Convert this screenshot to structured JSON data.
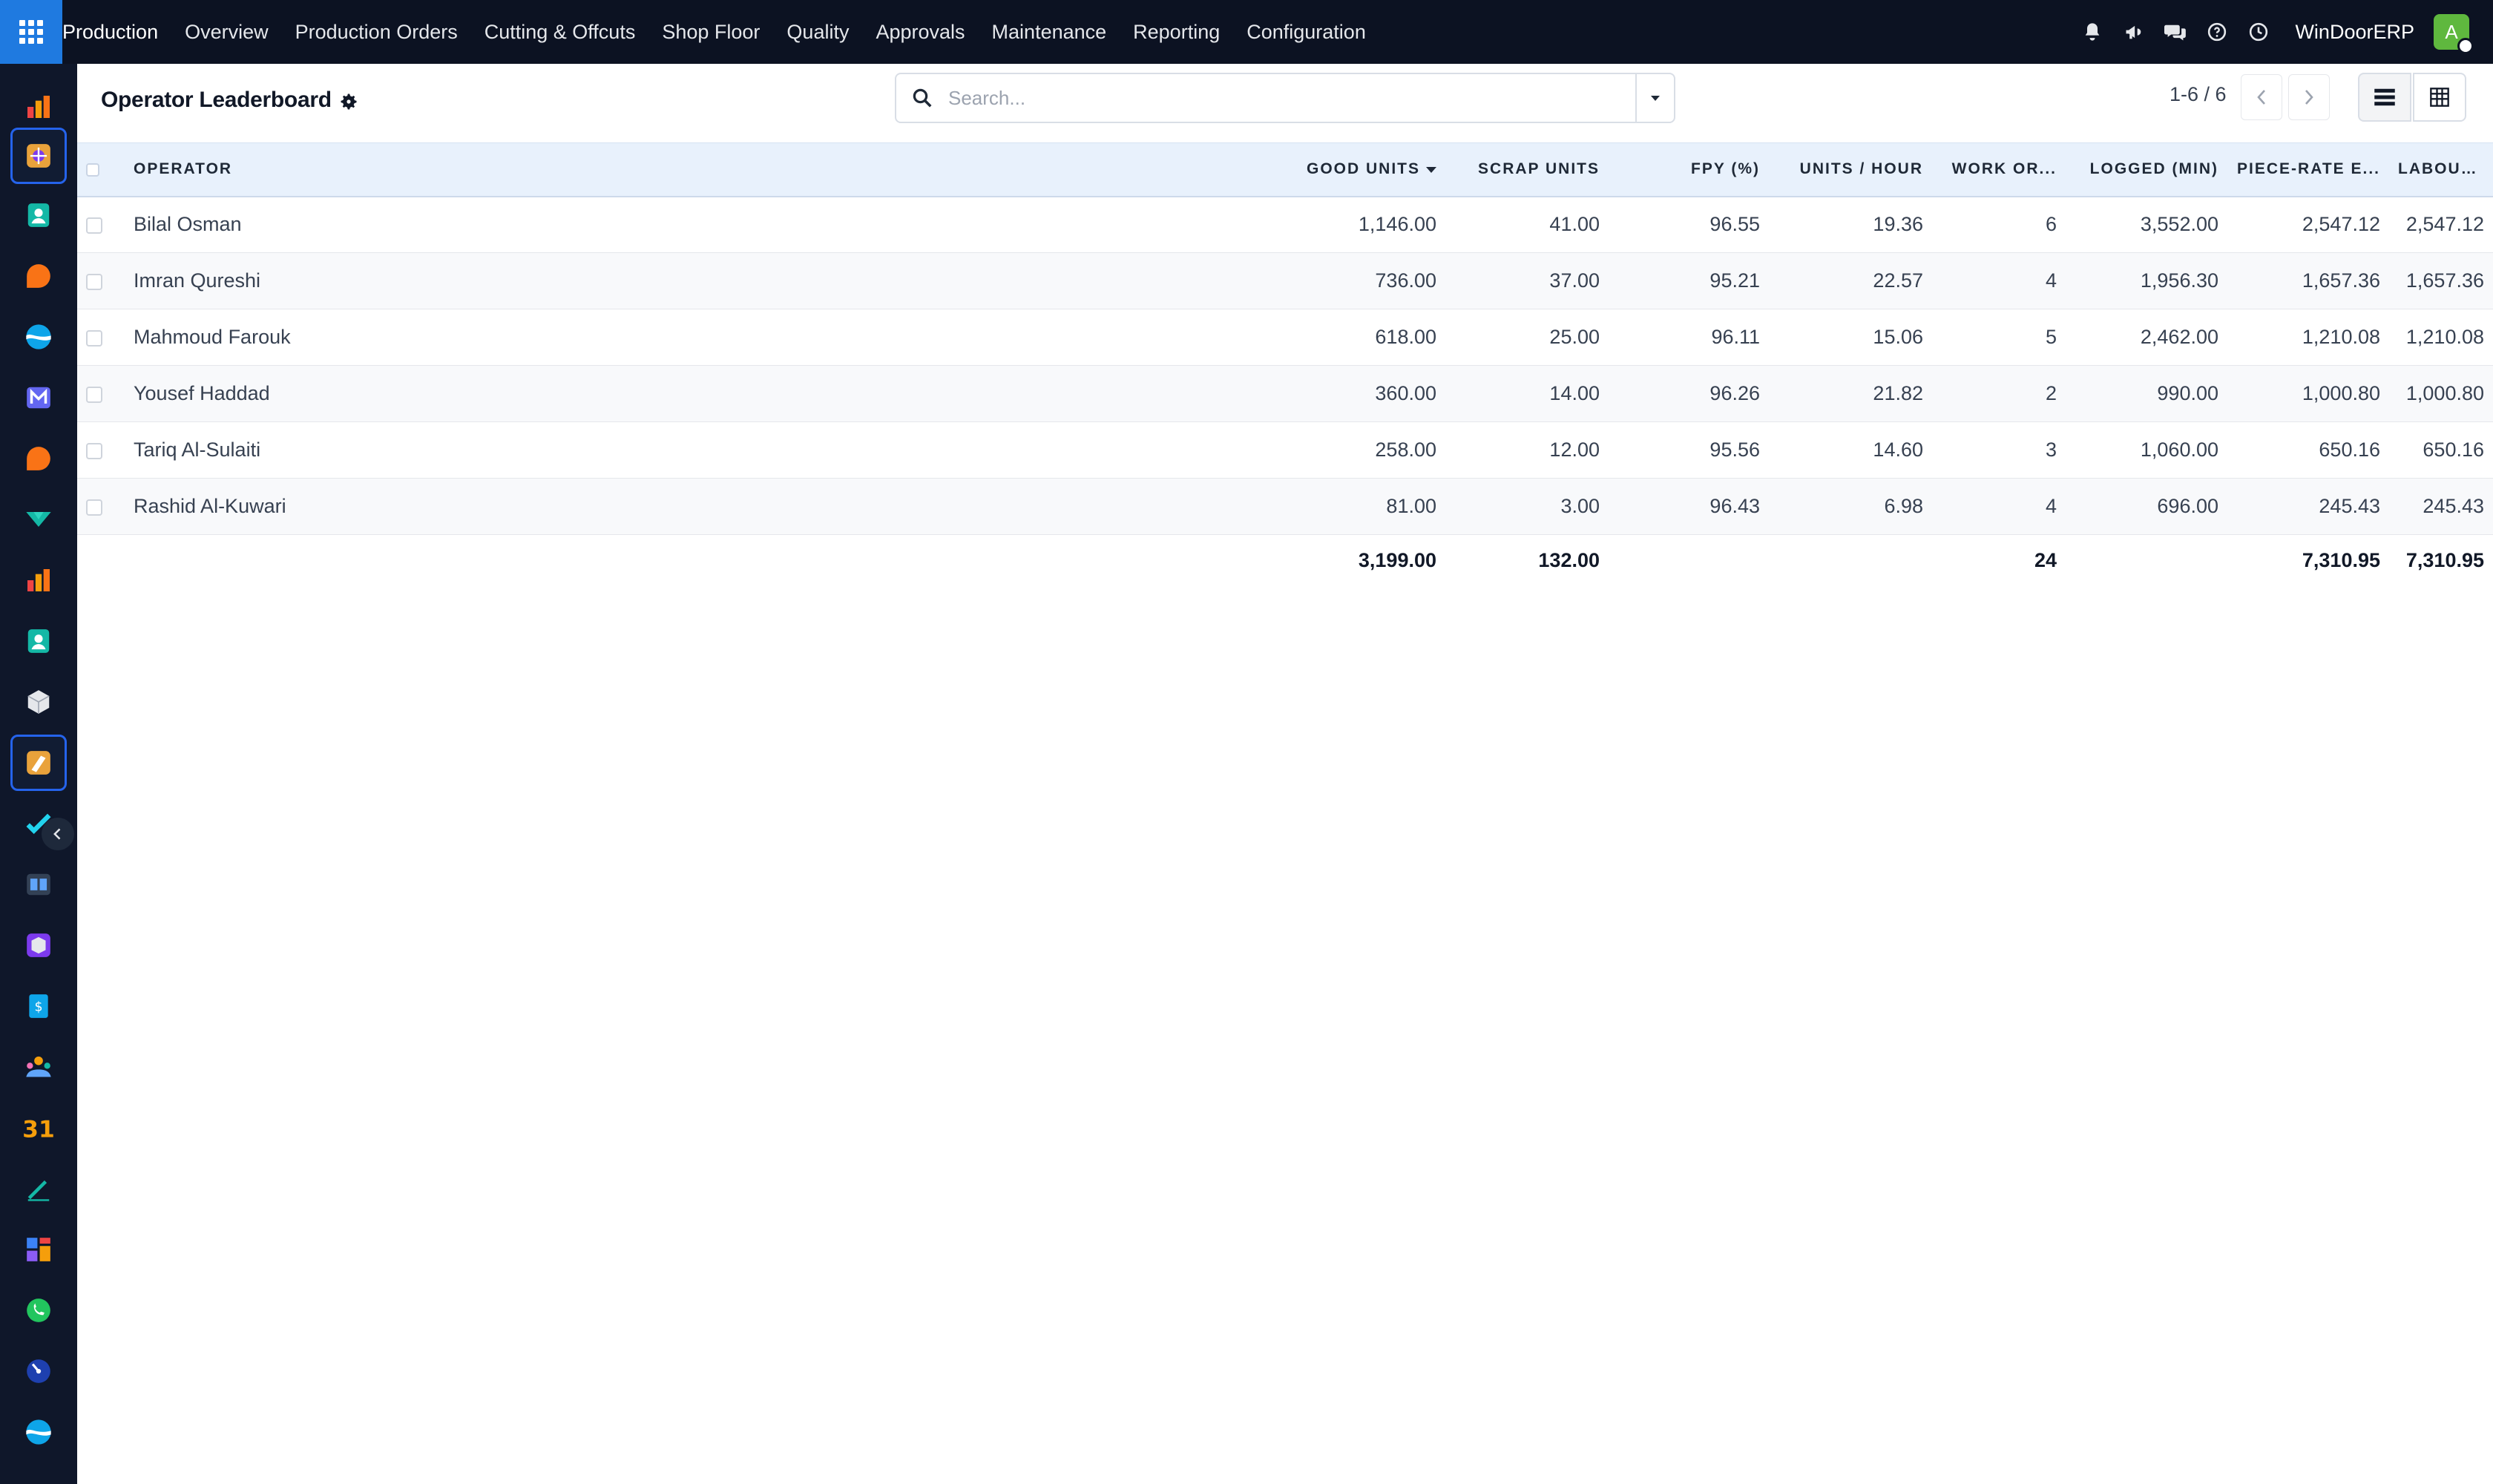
{
  "topbar": {
    "brand": "Production",
    "menu": [
      "Overview",
      "Production Orders",
      "Cutting & Offcuts",
      "Shop Floor",
      "Quality",
      "Approvals",
      "Maintenance",
      "Reporting",
      "Configuration"
    ],
    "company": "WinDoorERP",
    "avatar_initial": "A",
    "icons": [
      "bell-icon",
      "megaphone-icon",
      "chat-icon",
      "help-icon",
      "clock-icon"
    ]
  },
  "rail": {
    "apps": [
      {
        "name": "rail-app-dashboards-icon",
        "color": "#f59e0b"
      },
      {
        "name": "rail-app-production-icon",
        "color": "#f59e0b"
      },
      {
        "name": "rail-app-contacts-icon",
        "color": "#14b8a6"
      },
      {
        "name": "rail-app-discuss-icon",
        "color": "#f97316"
      },
      {
        "name": "rail-app-website-icon",
        "color": "#22d3ee"
      },
      {
        "name": "rail-app-email-icon",
        "color": "#6366f1"
      },
      {
        "name": "rail-app-livechat-icon",
        "color": "#f97316"
      },
      {
        "name": "rail-app-crm-icon",
        "color": "#14b8a6"
      },
      {
        "name": "rail-app-reports-icon",
        "color": "#f59e0b"
      },
      {
        "name": "rail-app-employees-icon",
        "color": "#14b8a6"
      },
      {
        "name": "rail-app-inventory-icon",
        "color": "#e5e7eb"
      },
      {
        "name": "rail-app-manufacturing-icon",
        "color": "#f59e0b"
      },
      {
        "name": "rail-app-project-icon",
        "color": "#22d3ee"
      },
      {
        "name": "rail-app-knowledge-icon",
        "color": "#60a5fa"
      },
      {
        "name": "rail-app-products-icon",
        "color": "#a78bfa"
      },
      {
        "name": "rail-app-invoicing-icon",
        "color": "#0ea5e9"
      },
      {
        "name": "rail-app-team-icon",
        "color": "#f472b6"
      },
      {
        "name": "rail-app-calendar-icon",
        "color": "#f59e0b"
      },
      {
        "name": "rail-app-sign-icon",
        "color": "#14b8a6"
      },
      {
        "name": "rail-app-apps-icon",
        "color": "#ef4444"
      },
      {
        "name": "rail-app-whatsapp-icon",
        "color": "#22c55e"
      },
      {
        "name": "rail-app-planning-icon",
        "color": "#3b82f6"
      },
      {
        "name": "rail-app-social-icon",
        "color": "#22d3ee"
      }
    ]
  },
  "panel": {
    "title": "Operator Leaderboard",
    "search_placeholder": "Search...",
    "pager": "1-6 / 6"
  },
  "table": {
    "columns": [
      "Operator",
      "Good Units",
      "Scrap Units",
      "FPY (%)",
      "Units / Hour",
      "Work Or...",
      "Logged (min)",
      "Piece-Rate E...",
      "Labour Cost"
    ],
    "sorted_column": "Good Units",
    "rows": [
      {
        "operator": "Bilal Osman",
        "good": "1,146.00",
        "scrap": "41.00",
        "fpy": "96.55",
        "uph": "19.36",
        "wo": "6",
        "logged": "3,552.00",
        "piece": "2,547.12",
        "labour": "2,547.12"
      },
      {
        "operator": "Imran Qureshi",
        "good": "736.00",
        "scrap": "37.00",
        "fpy": "95.21",
        "uph": "22.57",
        "wo": "4",
        "logged": "1,956.30",
        "piece": "1,657.36",
        "labour": "1,657.36"
      },
      {
        "operator": "Mahmoud Farouk",
        "good": "618.00",
        "scrap": "25.00",
        "fpy": "96.11",
        "uph": "15.06",
        "wo": "5",
        "logged": "2,462.00",
        "piece": "1,210.08",
        "labour": "1,210.08"
      },
      {
        "operator": "Yousef Haddad",
        "good": "360.00",
        "scrap": "14.00",
        "fpy": "96.26",
        "uph": "21.82",
        "wo": "2",
        "logged": "990.00",
        "piece": "1,000.80",
        "labour": "1,000.80"
      },
      {
        "operator": "Tariq Al-Sulaiti",
        "good": "258.00",
        "scrap": "12.00",
        "fpy": "95.56",
        "uph": "14.60",
        "wo": "3",
        "logged": "1,060.00",
        "piece": "650.16",
        "labour": "650.16"
      },
      {
        "operator": "Rashid Al-Kuwari",
        "good": "81.00",
        "scrap": "3.00",
        "fpy": "96.43",
        "uph": "6.98",
        "wo": "4",
        "logged": "696.00",
        "piece": "245.43",
        "labour": "245.43"
      }
    ],
    "totals": {
      "good": "3,199.00",
      "scrap": "132.00",
      "fpy": "",
      "uph": "",
      "wo": "24",
      "logged": "",
      "piece": "7,310.95",
      "labour": "7,310.95"
    }
  }
}
